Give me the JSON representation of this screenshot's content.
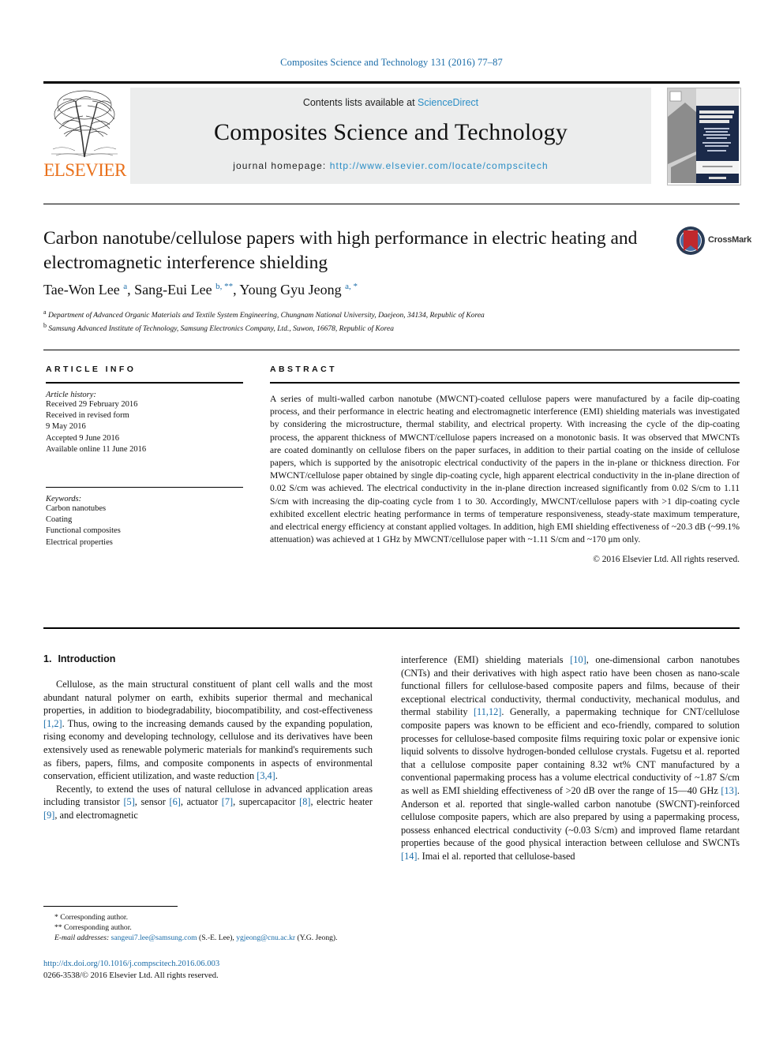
{
  "running_head": "Composites Science and Technology 131 (2016) 77–87",
  "masthead": {
    "contents_prefix": "Contents lists available at ",
    "sciencedirect": "ScienceDirect",
    "journal_name": "Composites Science and Technology",
    "homepage_label": "journal homepage: ",
    "homepage_url": "http://www.elsevier.com/locate/compscitech",
    "publisher": "ELSEVIER",
    "cover_title_line1": "COMPOSITES",
    "cover_title_line2": "SCIENCE AND",
    "cover_title_line3": "TECHNOLOGY"
  },
  "article": {
    "title": "Carbon nanotube/cellulose papers with high performance in electric heating and electromagnetic interference shielding",
    "crossmark_label": "CrossMark",
    "authors_html": "Tae-Won Lee <sup>a</sup>, Sang-Eui Lee <sup>b, **</sup>, Young Gyu Jeong <sup>a, *</sup>",
    "affiliation_a": "Department of Advanced Organic Materials and Textile System Engineering, Chungnam National University, Daejeon, 34134, Republic of Korea",
    "affiliation_b": "Samsung Advanced Institute of Technology, Samsung Electronics Company, Ltd., Suwon, 16678, Republic of Korea"
  },
  "article_info": {
    "heading": "ARTICLE INFO",
    "history_title": "Article history:",
    "history": [
      "Received 29 February 2016",
      "Received in revised form",
      "9 May 2016",
      "Accepted 9 June 2016",
      "Available online 11 June 2016"
    ],
    "keywords_title": "Keywords:",
    "keywords": [
      "Carbon nanotubes",
      "Coating",
      "Functional composites",
      "Electrical properties"
    ]
  },
  "abstract": {
    "heading": "ABSTRACT",
    "text": "A series of multi-walled carbon nanotube (MWCNT)-coated cellulose papers were manufactured by a facile dip-coating process, and their performance in electric heating and electromagnetic interference (EMI) shielding materials was investigated by considering the microstructure, thermal stability, and electrical property. With increasing the cycle of the dip-coating process, the apparent thickness of MWCNT/cellulose papers increased on a monotonic basis. It was observed that MWCNTs are coated dominantly on cellulose fibers on the paper surfaces, in addition to their partial coating on the inside of cellulose papers, which is supported by the anisotropic electrical conductivity of the papers in the in-plane or thickness direction. For MWCNT/cellulose paper obtained by single dip-coating cycle, high apparent electrical conductivity in the in-plane direction of 0.02 S/cm was achieved. The electrical conductivity in the in-plane direction increased significantly from 0.02 S/cm to 1.11 S/cm with increasing the dip-coating cycle from 1 to 30. Accordingly, MWCNT/cellulose papers with >1 dip-coating cycle exhibited excellent electric heating performance in terms of temperature responsiveness, steady-state maximum temperature, and electrical energy efficiency at constant applied voltages. In addition, high EMI shielding effectiveness of ~20.3 dB (~99.1% attenuation) was achieved at 1 GHz by MWCNT/cellulose paper with ~1.11 S/cm and ~170 μm only.",
    "copyright": "© 2016 Elsevier Ltd. All rights reserved."
  },
  "introduction": {
    "number": "1.",
    "heading": "Introduction",
    "left_paragraphs": [
      "Cellulose, as the main structural constituent of plant cell walls and the most abundant natural polymer on earth, exhibits superior thermal and mechanical properties, in addition to biodegradability, biocompatibility, and cost-effectiveness <span class=\"ref\">[1,2]</span>. Thus, owing to the increasing demands caused by the expanding population, rising economy and developing technology, cellulose and its derivatives have been extensively used as renewable polymeric materials for mankind's requirements such as fibers, papers, films, and composite components in aspects of environmental conservation, efficient utilization, and waste reduction <span class=\"ref\">[3,4]</span>.",
      "Recently, to extend the uses of natural cellulose in advanced application areas including transistor <span class=\"ref\">[5]</span>, sensor <span class=\"ref\">[6]</span>, actuator <span class=\"ref\">[7]</span>, supercapacitor <span class=\"ref\">[8]</span>, electric heater <span class=\"ref\">[9]</span>, and electromagnetic"
    ],
    "right_paragraphs": [
      "interference (EMI) shielding materials <span class=\"ref\">[10]</span>, one-dimensional carbon nanotubes (CNTs) and their derivatives with high aspect ratio have been chosen as nano-scale functional fillers for cellulose-based composite papers and films, because of their exceptional electrical conductivity, thermal conductivity, mechanical modulus, and thermal stability <span class=\"ref\">[11,12]</span>. Generally, a papermaking technique for CNT/cellulose composite papers was known to be efficient and eco-friendly, compared to solution processes for cellulose-based composite films requiring toxic polar or expensive ionic liquid solvents to dissolve hydrogen-bonded cellulose crystals. Fugetsu et al. reported that a cellulose composite paper containing 8.32 wt% CNT manufactured by a conventional papermaking process has a volume electrical conductivity of ~1.87 S/cm as well as EMI shielding effectiveness of >20 dB over the range of 15—40 GHz <span class=\"ref\">[13]</span>. Anderson et al. reported that single-walled carbon nanotube (SWCNT)-reinforced cellulose composite papers, which are also prepared by using a papermaking process, possess enhanced electrical conductivity (~0.03 S/cm) and improved flame retardant properties because of the good physical interaction between cellulose and SWCNTs <span class=\"ref\">[14]</span>. Imai el al. reported that cellulose-based"
    ]
  },
  "footnotes": {
    "single_star": "* Corresponding author.",
    "double_star": "** Corresponding author.",
    "email_label": "E-mail addresses:",
    "email_1": "sangeui7.lee@samsung.com",
    "email_1_owner": "(S.-E. Lee),",
    "email_2": "ygjeong@cnu.ac.kr",
    "email_2_owner": "(Y.G. Jeong)."
  },
  "footer": {
    "doi": "http://dx.doi.org/10.1016/j.compscitech.2016.06.003",
    "issn_copyright": "0266-3538/© 2016 Elsevier Ltd. All rights reserved."
  },
  "colors": {
    "link_blue": "#1a6ca8",
    "sciencedirect_blue": "#2b8ec6",
    "elsevier_orange": "#E9711C",
    "band_gray": "#eceded",
    "crossmark_red": "#C0282D"
  }
}
